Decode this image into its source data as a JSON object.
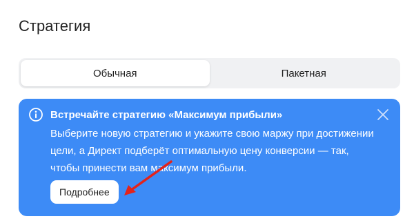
{
  "section": {
    "title": "Стратегия"
  },
  "tabs": [
    {
      "label": "Обычная",
      "active": true
    },
    {
      "label": "Пакетная",
      "active": false
    }
  ],
  "banner": {
    "title": "Встречайте стратегию «Максимум прибыли»",
    "text": "Выберите новую стратегию и укажите свою маржу при достижении цели, а Директ подберёт оптимальную цену конверсии — так, чтобы принести вам максимум прибыли.",
    "button_label": "Подробнее",
    "background_color": "#3d8bf6"
  },
  "annotation": {
    "arrow_color": "#e3231b"
  },
  "icons": {
    "info": "info-icon",
    "close": "close-icon"
  }
}
